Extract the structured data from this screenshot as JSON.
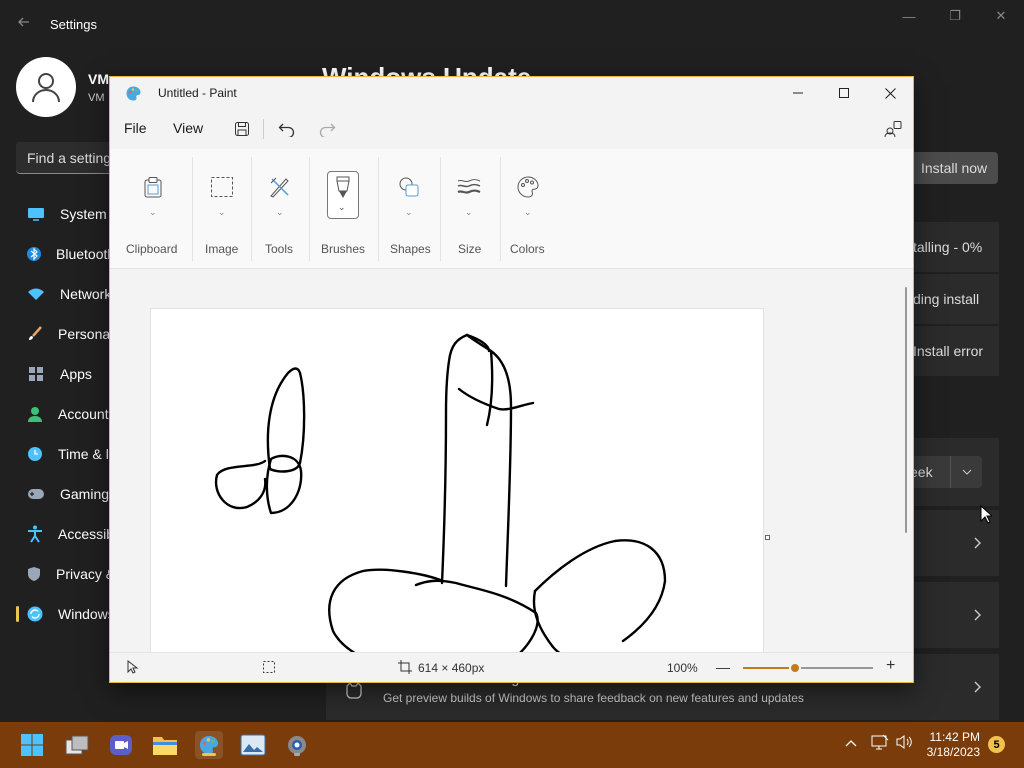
{
  "settings": {
    "title": "Settings",
    "user": {
      "name": "VM",
      "sub": "VM"
    },
    "search_placeholder": "Find a setting",
    "nav": [
      {
        "label": "System",
        "icon": "monitor-icon",
        "color": "#4cc2ff"
      },
      {
        "label": "Bluetooth & devices",
        "icon": "bluetooth-icon",
        "color": "#1f8ae0"
      },
      {
        "label": "Network & internet",
        "icon": "wifi-icon",
        "color": "#4cc2ff"
      },
      {
        "label": "Personalization",
        "icon": "brush-icon",
        "color": "#e8a36b"
      },
      {
        "label": "Apps",
        "icon": "apps-icon",
        "color": "#9aa7b6"
      },
      {
        "label": "Accounts",
        "icon": "person-icon",
        "color": "#3fc07a"
      },
      {
        "label": "Time & language",
        "icon": "clock-globe-icon",
        "color": "#4cc2ff"
      },
      {
        "label": "Gaming",
        "icon": "gamepad-icon",
        "color": "#9aa7b6"
      },
      {
        "label": "Accessibility",
        "icon": "accessibility-icon",
        "color": "#4cc2ff"
      },
      {
        "label": "Privacy & security",
        "icon": "shield-icon",
        "color": "#9aa7b6"
      },
      {
        "label": "Windows Update",
        "icon": "update-icon",
        "color": "#4cc2ff"
      }
    ],
    "page_title": "Windows Update",
    "install_now": "Install now",
    "status_lines": [
      "talling - 0%",
      "ding install",
      "Install error"
    ],
    "pause_value": "eek",
    "insider": {
      "title": "Windows Insider Program",
      "desc": "Get preview builds of Windows to share feedback on new features and updates"
    }
  },
  "paint": {
    "title": "Untitled - Paint",
    "menu": {
      "file": "File",
      "view": "View"
    },
    "groups": [
      "Clipboard",
      "Image",
      "Tools",
      "Brushes",
      "Shapes",
      "Size",
      "Colors"
    ],
    "status": {
      "dimensions": "614 × 460px",
      "zoom": "100%"
    },
    "zoom_fraction": 0.4
  },
  "taskbar": {
    "time": "11:42 PM",
    "date": "3/18/2023",
    "notifications": "5"
  }
}
